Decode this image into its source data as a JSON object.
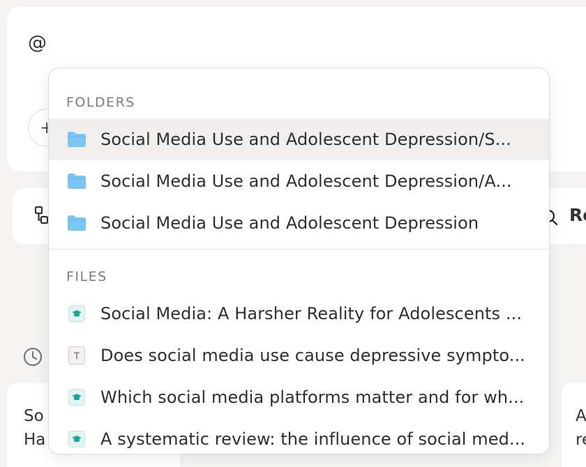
{
  "composer": {
    "input_value": "@",
    "plus_label": "+"
  },
  "toolbar": {
    "right_label": "Re"
  },
  "cards": [
    {
      "lines": [
        "So",
        "Ha"
      ]
    },
    {
      "lines": [
        "A",
        "re"
      ]
    }
  ],
  "dropdown": {
    "folders_header": "FOLDERS",
    "folders": [
      {
        "label": "Social Media Use and Adolescent Depression/S...",
        "icon": "folder-icon",
        "highlighted": true
      },
      {
        "label": "Social Media Use and Adolescent Depression/A...",
        "icon": "folder-icon",
        "highlighted": false
      },
      {
        "label": "Social Media Use and Adolescent Depression",
        "icon": "folder-icon",
        "highlighted": false
      }
    ],
    "files_header": "FILES",
    "files": [
      {
        "label": "Social Media: A Harsher Reality for Adolescents ...",
        "icon": "paper-icon"
      },
      {
        "label": "Does social media use cause depressive sympto...",
        "icon": "text-doc-icon",
        "icon_text": "T"
      },
      {
        "label": "Which social media platforms matter and for wh...",
        "icon": "paper-icon"
      },
      {
        "label": "A systematic review: the influence of social med...",
        "icon": "paper-icon"
      }
    ]
  },
  "colors": {
    "folder": "#7cc4f2",
    "paper_icon": "#1fa39a",
    "highlight": "#f0efed",
    "background": "#f5f4f2"
  }
}
